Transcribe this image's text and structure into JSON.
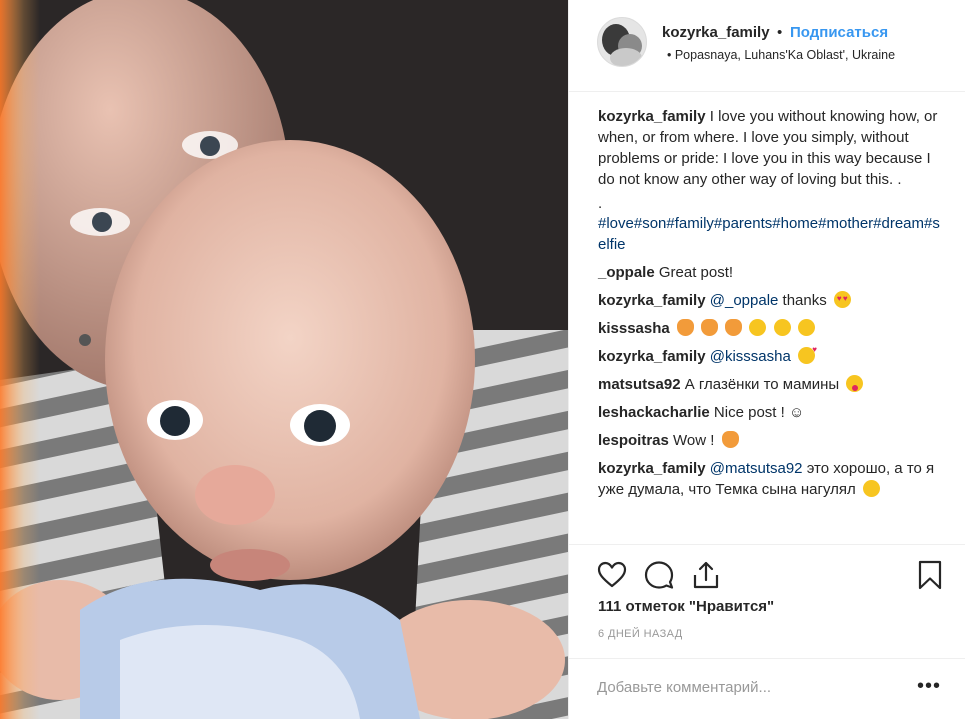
{
  "header": {
    "username": "kozyrka_family",
    "separator": "•",
    "follow_label": "Подписаться",
    "location": "• Popasnaya, Luhans'Ka Oblast', Ukraine"
  },
  "caption": {
    "user": "kozyrka_family",
    "text": "I love you without knowing how, or when, or from where. I love you simply, without problems or pride: I love you in this way because I do not know any other way of loving but this. .",
    "dot_line": ".",
    "hashtags": "#love#son#family#parents#home#mother#dream#selfie"
  },
  "comments": [
    {
      "user": "_oppale",
      "text": "Great post!"
    },
    {
      "user": "kozyrka_family",
      "mention": "@_oppale",
      "text": "thanks"
    },
    {
      "user": "kisssasha",
      "text": ""
    },
    {
      "user": "kozyrka_family",
      "mention": "@kisssasha",
      "text": ""
    },
    {
      "user": "matsutsa92",
      "text": "А глазёнки то мамины"
    },
    {
      "user": "leshackacharlie",
      "text": "Nice post ! ☺"
    },
    {
      "user": "lespoitras",
      "text": "Wow !"
    },
    {
      "user": "kozyrka_family",
      "mention": "@matsutsa92",
      "text": "это хорошо, а то я уже думала, что Темка сына нагулял"
    }
  ],
  "actions": {
    "icons": [
      "heart-icon",
      "comment-icon",
      "share-icon",
      "bookmark-icon"
    ]
  },
  "likes_text": "111 отметок \"Нравится\"",
  "timestamp": "6 ДНЕЙ НАЗАД",
  "add_comment_placeholder": "Добавьте комментарий...",
  "more_label": "•••",
  "colors": {
    "link": "#3897f0",
    "hashtag": "#003569",
    "muted": "#999999"
  }
}
